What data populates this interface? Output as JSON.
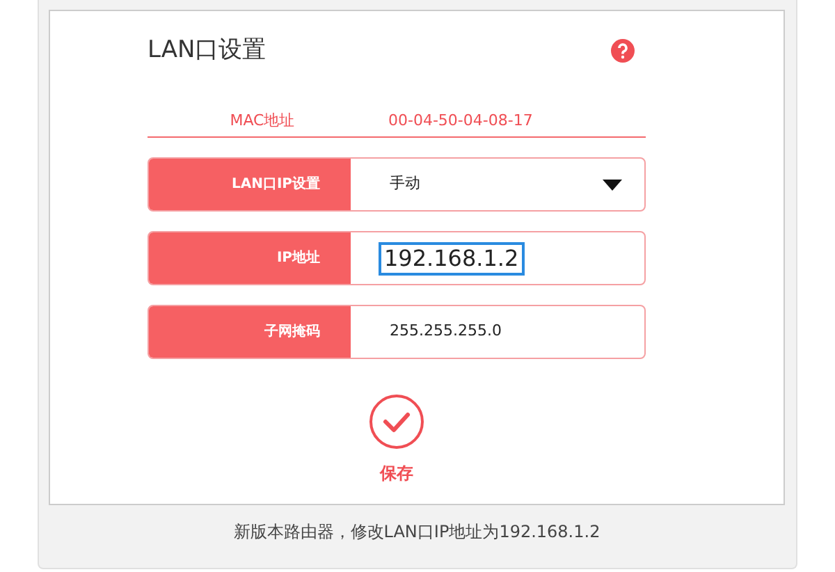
{
  "title": "LAN口设置",
  "mac": {
    "label": "MAC地址",
    "value": "00-04-50-04-08-17"
  },
  "fields": [
    {
      "kind": "select",
      "label": "LAN口IP设置",
      "value": "手动",
      "focused": false
    },
    {
      "kind": "input",
      "label": "IP地址",
      "value": "192.168.1.2",
      "focused": true
    },
    {
      "kind": "input",
      "label": "子网掩码",
      "value": "255.255.255.0",
      "focused": false
    }
  ],
  "save": {
    "label": "保存"
  },
  "caption": "新版本路由器，修改LAN口IP地址为192.168.1.2"
}
